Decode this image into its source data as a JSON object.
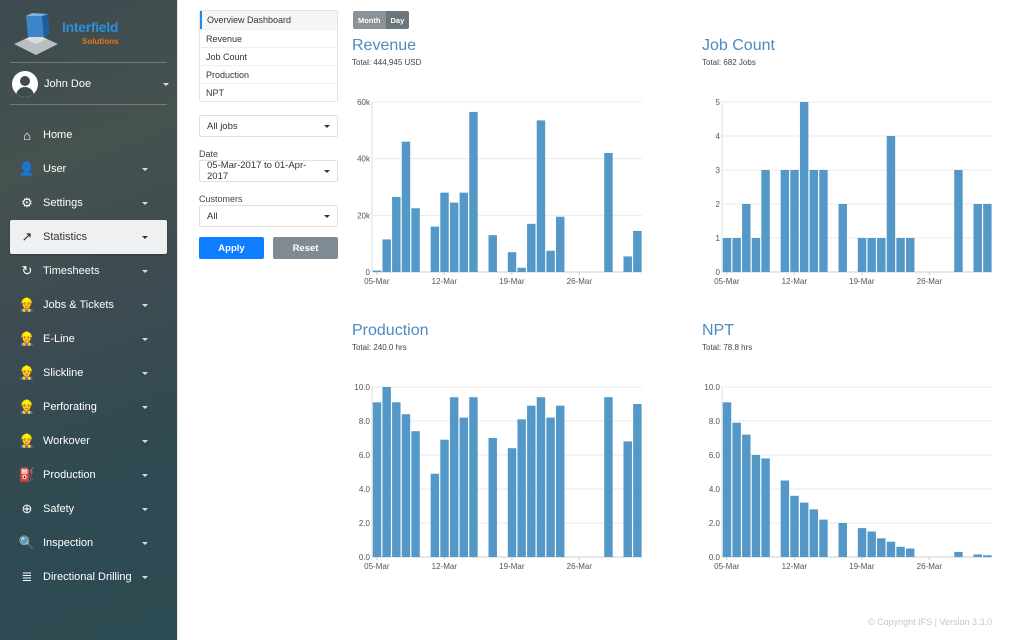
{
  "brand": {
    "name": "Interfield",
    "sub": "Solutions"
  },
  "user": {
    "name": "John Doe"
  },
  "sidebar": {
    "items": [
      {
        "label": "Home",
        "icon": "home-icon",
        "glyph": "⌂",
        "caret": false,
        "active": false
      },
      {
        "label": "User",
        "icon": "user-icon",
        "glyph": "👤",
        "caret": true,
        "active": false
      },
      {
        "label": "Settings",
        "icon": "gear-icon",
        "glyph": "⚙",
        "caret": true,
        "active": false
      },
      {
        "label": "Statistics",
        "icon": "trending-up-icon",
        "glyph": "↗",
        "caret": true,
        "active": true
      },
      {
        "label": "Timesheets",
        "icon": "history-icon",
        "glyph": "↻",
        "caret": true,
        "active": false
      },
      {
        "label": "Jobs & Tickets",
        "icon": "worker-icon",
        "glyph": "👷",
        "caret": true,
        "active": false
      },
      {
        "label": "E-Line",
        "icon": "worker-icon",
        "glyph": "👷",
        "caret": true,
        "active": false
      },
      {
        "label": "Slickline",
        "icon": "worker-icon",
        "glyph": "👷",
        "caret": true,
        "active": false
      },
      {
        "label": "Perforating",
        "icon": "worker-icon",
        "glyph": "👷",
        "caret": true,
        "active": false
      },
      {
        "label": "Workover",
        "icon": "worker-icon",
        "glyph": "👷",
        "caret": true,
        "active": false
      },
      {
        "label": "Production",
        "icon": "oil-pump-icon",
        "glyph": "⛽",
        "caret": true,
        "active": false
      },
      {
        "label": "Safety",
        "icon": "life-ring-icon",
        "glyph": "⊕",
        "caret": true,
        "active": false
      },
      {
        "label": "Inspection",
        "icon": "inspector-icon",
        "glyph": "🔍",
        "caret": true,
        "active": false
      },
      {
        "label": "Directional Drilling",
        "icon": "database-icon",
        "glyph": "≣",
        "caret": true,
        "active": false
      }
    ]
  },
  "filters": {
    "reports": [
      "Overview Dashboard",
      "Revenue",
      "Job Count",
      "Production",
      "NPT"
    ],
    "job_type": "All jobs",
    "date_label": "Date",
    "date_range": "05-Mar-2017 to 01-Apr-2017",
    "customers_label": "Customers",
    "customers": "All",
    "apply": "Apply",
    "reset": "Reset"
  },
  "toggle": {
    "month": "Month",
    "day": "Day"
  },
  "footer": "© Copyright IFS  |  Version 3.3.0",
  "colors": {
    "bar": "#5498c8",
    "title": "#4a8bc2",
    "apply": "#0f7dff",
    "reset": "#7f8a93"
  },
  "chart_data": [
    {
      "type": "bar",
      "title": "Revenue",
      "subtitle": "Total: 444,945 USD",
      "xlabel": "",
      "ylabel": "",
      "ylim": [
        0,
        60000
      ],
      "yticks": [
        0,
        20000,
        40000,
        60000
      ],
      "ytick_labels": [
        "0",
        "20k",
        "40k",
        "60k"
      ],
      "x_start": "05-Mar",
      "x_end": "01-Apr",
      "xtick_labels": [
        "05-Mar",
        "12-Mar",
        "19-Mar",
        "26-Mar"
      ],
      "xtick_index": [
        0,
        7,
        14,
        21
      ],
      "grid": true,
      "values": [
        500,
        11500,
        26500,
        46000,
        22500,
        null,
        16000,
        28000,
        24500,
        28000,
        56500,
        null,
        13000,
        null,
        7000,
        1500,
        17000,
        53500,
        7500,
        19500,
        null,
        null,
        null,
        null,
        42000,
        null,
        5500,
        14500
      ]
    },
    {
      "type": "bar",
      "title": "Job Count",
      "subtitle": "Total: 682 Jobs",
      "xlabel": "",
      "ylabel": "",
      "ylim": [
        0,
        5
      ],
      "yticks": [
        0,
        1,
        2,
        3,
        4,
        5
      ],
      "ytick_labels": [
        "0",
        "1",
        "2",
        "3",
        "4",
        "5"
      ],
      "x_start": "05-Mar",
      "x_end": "01-Apr",
      "xtick_labels": [
        "05-Mar",
        "12-Mar",
        "19-Mar",
        "26-Mar"
      ],
      "xtick_index": [
        0,
        7,
        14,
        21
      ],
      "grid": true,
      "values": [
        1,
        1,
        2,
        1,
        3,
        null,
        3,
        3,
        5,
        3,
        3,
        null,
        2,
        null,
        1,
        1,
        1,
        4,
        1,
        1,
        null,
        null,
        null,
        null,
        3,
        null,
        2,
        2
      ]
    },
    {
      "type": "bar",
      "title": "Production",
      "subtitle": "Total: 240.0 hrs",
      "xlabel": "",
      "ylabel": "",
      "ylim": [
        0,
        10
      ],
      "yticks": [
        0,
        2,
        4,
        6,
        8,
        10
      ],
      "ytick_labels": [
        "0.0",
        "2.0",
        "4.0",
        "6.0",
        "8.0",
        "10.0"
      ],
      "x_start": "05-Mar",
      "x_end": "01-Apr",
      "xtick_labels": [
        "05-Mar",
        "12-Mar",
        "19-Mar",
        "26-Mar"
      ],
      "xtick_index": [
        0,
        7,
        14,
        21
      ],
      "grid": true,
      "values": [
        9.1,
        10.0,
        9.1,
        8.4,
        7.4,
        null,
        4.9,
        6.9,
        9.4,
        8.2,
        9.4,
        null,
        7.0,
        null,
        6.4,
        8.1,
        8.9,
        9.4,
        8.2,
        8.9,
        null,
        null,
        null,
        null,
        9.4,
        null,
        6.8,
        9.0
      ]
    },
    {
      "type": "bar",
      "title": "NPT",
      "subtitle": "Total: 78.8 hrs",
      "xlabel": "",
      "ylabel": "",
      "ylim": [
        0,
        10
      ],
      "yticks": [
        0,
        2,
        4,
        6,
        8,
        10
      ],
      "ytick_labels": [
        "0.0",
        "2.0",
        "4.0",
        "6.0",
        "8.0",
        "10.0"
      ],
      "x_start": "05-Mar",
      "x_end": "01-Apr",
      "xtick_labels": [
        "05-Mar",
        "12-Mar",
        "19-Mar",
        "26-Mar"
      ],
      "xtick_index": [
        0,
        7,
        14,
        21
      ],
      "grid": true,
      "values": [
        9.1,
        7.9,
        7.2,
        6.0,
        5.8,
        null,
        4.5,
        3.6,
        3.2,
        2.8,
        2.2,
        null,
        2.0,
        null,
        1.7,
        1.5,
        1.1,
        0.9,
        0.6,
        0.5,
        null,
        null,
        null,
        null,
        0.3,
        null,
        0.15,
        0.1
      ]
    }
  ]
}
